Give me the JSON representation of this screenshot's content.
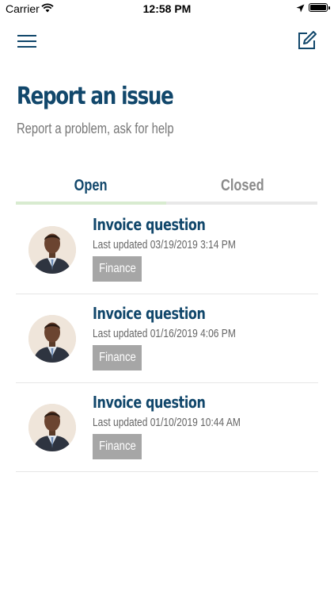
{
  "status_bar": {
    "carrier": "Carrier",
    "time": "12:58 PM",
    "icons": [
      "wifi-icon",
      "location-arrow-icon",
      "battery-icon"
    ]
  },
  "nav": {
    "left_icon": "menu-icon",
    "right_icon": "compose-icon"
  },
  "header": {
    "title": "Report an issue",
    "subtitle": "Report a problem, ask for help"
  },
  "tabs": [
    {
      "label": "Open",
      "active": true
    },
    {
      "label": "Closed",
      "active": false
    }
  ],
  "issues": [
    {
      "title": "Invoice question",
      "updated": "Last updated 03/19/2019 3:14 PM",
      "category": "Finance"
    },
    {
      "title": "Invoice question",
      "updated": "Last updated 01/16/2019 4:06 PM",
      "category": "Finance"
    },
    {
      "title": "Invoice question",
      "updated": "Last updated 01/10/2019 10:44 AM",
      "category": "Finance"
    }
  ],
  "colors": {
    "primary": "#11476b",
    "subtitle_text": "#777777",
    "inactive_tab": "#8a8a8a",
    "tab_indicator": "#d8ebd0",
    "badge_bg": "#a6a6a6"
  }
}
